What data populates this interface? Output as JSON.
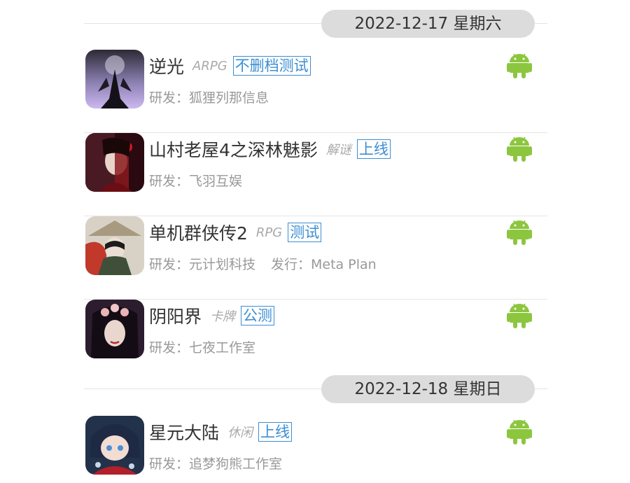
{
  "groups": [
    {
      "date": "2022-12-17 星期六",
      "games": [
        {
          "name": "逆光",
          "genre": "ARPG",
          "tag": "不删档测试",
          "developer": "研发：狐狸列那信息",
          "publisher": "",
          "platform_icon": "android-icon"
        },
        {
          "name": "山村老屋4之深林魅影",
          "genre": "解谜",
          "tag": "上线",
          "developer": "研发：飞羽互娱",
          "publisher": "",
          "platform_icon": "android-icon"
        },
        {
          "name": "单机群侠传2",
          "genre": "RPG",
          "tag": "测试",
          "developer": "研发：元计划科技",
          "publisher": "发行：Meta Plan",
          "platform_icon": "android-icon"
        },
        {
          "name": "阴阳界",
          "genre": "卡牌",
          "tag": "公测",
          "developer": "研发：七夜工作室",
          "publisher": "",
          "platform_icon": "android-icon"
        }
      ]
    },
    {
      "date": "2022-12-18 星期日",
      "games": [
        {
          "name": "星元大陆",
          "genre": "休闲",
          "tag": "上线",
          "developer": "研发：追梦狗熊工作室",
          "publisher": "",
          "platform_icon": "android-icon"
        }
      ]
    }
  ],
  "colors": {
    "tag": "#3c8ed2",
    "android": "#8cc63f",
    "date_pill": "#dcdcdc"
  }
}
